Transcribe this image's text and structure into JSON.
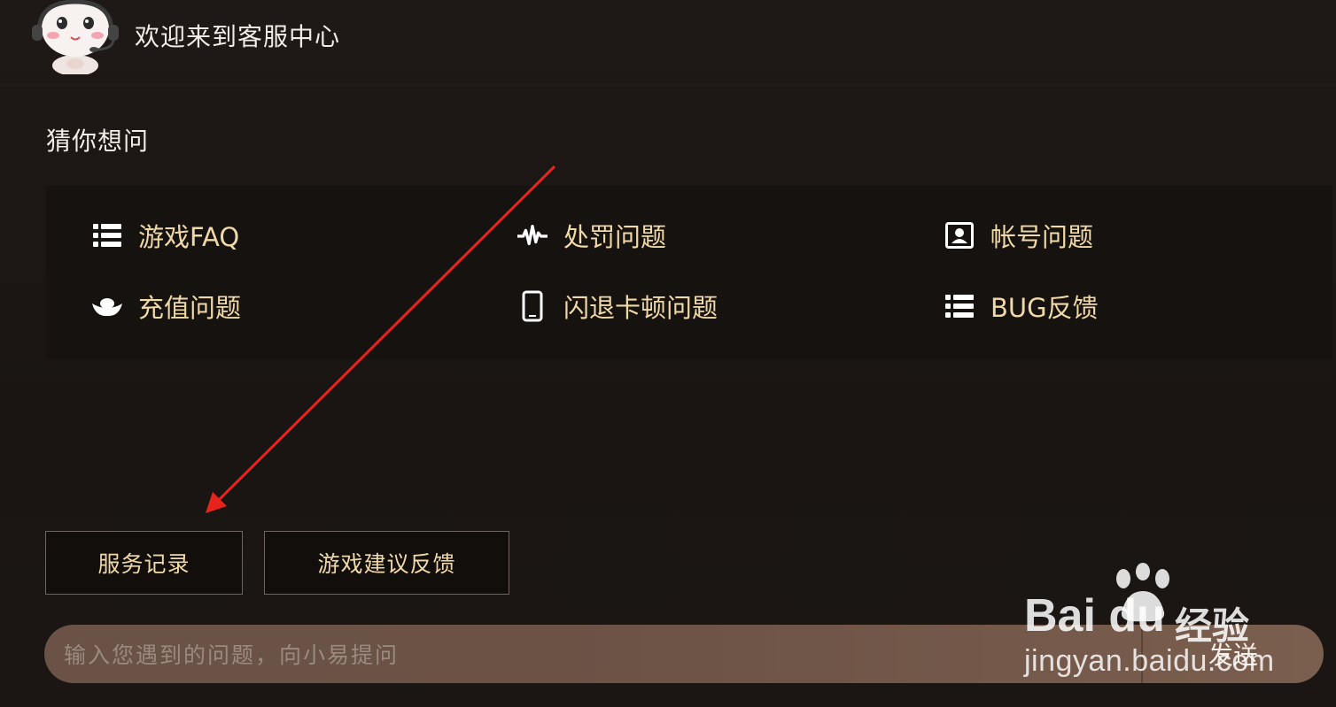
{
  "header": {
    "title": "欢迎来到客服中心",
    "avatar_icon": "customer-service-mascot-icon"
  },
  "guess": {
    "title": "猜你想问",
    "items": [
      {
        "label": "游戏FAQ",
        "icon": "list-icon"
      },
      {
        "label": "处罚问题",
        "icon": "pulse-icon"
      },
      {
        "label": "帐号问题",
        "icon": "account-card-icon"
      },
      {
        "label": "充值问题",
        "icon": "ingot-icon"
      },
      {
        "label": "闪退卡顿问题",
        "icon": "phone-icon"
      },
      {
        "label": "BUG反馈",
        "icon": "list-icon"
      }
    ]
  },
  "actions": {
    "service_records": "服务记录",
    "game_suggestion": "游戏建议反馈"
  },
  "input": {
    "placeholder": "输入您遇到的问题，向小易提问",
    "send_label": "发送"
  },
  "watermark": {
    "brand": "Bai du",
    "cn": "经验",
    "url": "jingyan.baidu.com"
  },
  "colors": {
    "accent_text": "#f0d9a8",
    "annotation_arrow": "#e8231c"
  }
}
